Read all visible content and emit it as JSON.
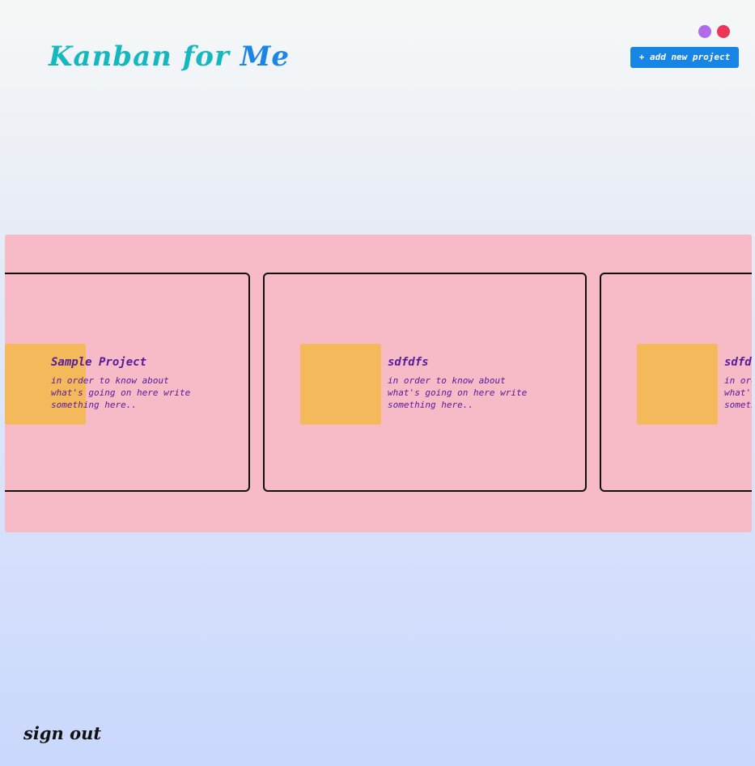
{
  "header": {
    "title_part1": "Kanban for",
    "title_part2": "Me",
    "add_button_label": "+ add new project",
    "theme_dots": [
      {
        "name": "purple",
        "color": "#b06aeb"
      },
      {
        "name": "red",
        "color": "#ec3558"
      }
    ]
  },
  "board": {
    "background": "#f7bac7",
    "projects": [
      {
        "title": "Sample Project",
        "description": "in order to know about what's going on here write something here..",
        "thumb_color": "#f3b95a"
      },
      {
        "title": "sdfdfs",
        "description": "in order to know about what's going on here write something here..",
        "thumb_color": "#f3b95a"
      },
      {
        "title": "sdfdfs",
        "description": "in order to know about what's going on here write something here..",
        "thumb_color": "#f3b95a"
      }
    ]
  },
  "footer": {
    "signout_label": "sign out"
  }
}
